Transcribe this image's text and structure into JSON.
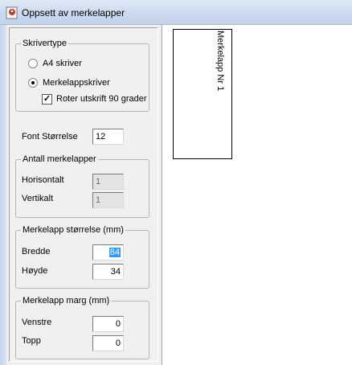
{
  "window": {
    "title": "Oppsett av merkelapper",
    "icon": "app-icon"
  },
  "printer_type": {
    "title": "Skrivertype",
    "options": [
      {
        "label": "A4 skriver",
        "selected": false
      },
      {
        "label": "Merkelappskriver",
        "selected": true
      }
    ],
    "rotate": {
      "label": "Roter utskrift 90 grader",
      "checked": true
    }
  },
  "font_size": {
    "label": "Font Størrelse",
    "value": "12"
  },
  "label_count": {
    "title": "Antall merkelapper",
    "horizontal": {
      "label": "Horisontalt",
      "value": "1"
    },
    "vertical": {
      "label": "Vertikalt",
      "value": "1"
    }
  },
  "label_size": {
    "title": "Merkelapp størrelse (mm)",
    "width": {
      "label": "Bredde",
      "value": "84"
    },
    "height": {
      "label": "Høyde",
      "value": "34"
    }
  },
  "label_margin": {
    "title": "Merkelapp marg (mm)",
    "left": {
      "label": "Venstre",
      "value": "0"
    },
    "top": {
      "label": "Topp",
      "value": "0"
    }
  },
  "preview": {
    "label_text": "Merkelapp Nr 1"
  },
  "colors": {
    "selection": "#3399ff",
    "titlebar": "#c9d9ee"
  }
}
